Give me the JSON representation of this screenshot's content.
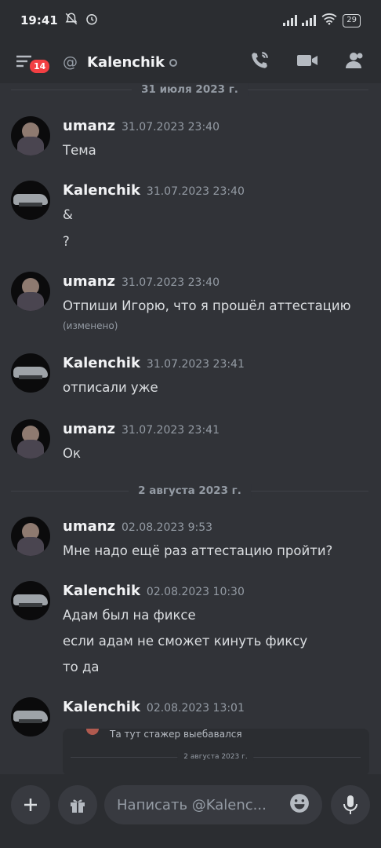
{
  "status": {
    "time": "19:41",
    "battery": "29"
  },
  "header": {
    "badge": "14",
    "channel": "Kalenchik"
  },
  "dividers": [
    "31 июля 2023 г.",
    "2 августа 2023 г."
  ],
  "messages": [
    {
      "author": "umanz",
      "time": "31.07.2023 23:40",
      "lines": [
        "Тема"
      ],
      "avatar": "girl"
    },
    {
      "author": "Kalenchik",
      "time": "31.07.2023 23:40",
      "lines": [
        "&",
        "?"
      ],
      "avatar": "car"
    },
    {
      "author": "umanz",
      "time": "31.07.2023 23:40",
      "lines": [
        "Отпиши Игорю, что я прошёл аттестацию"
      ],
      "edited": "(изменено)",
      "avatar": "girl"
    },
    {
      "author": "Kalenchik",
      "time": "31.07.2023 23:41",
      "lines": [
        "отписали уже"
      ],
      "avatar": "car"
    },
    {
      "author": "umanz",
      "time": "31.07.2023 23:41",
      "lines": [
        "Ок"
      ],
      "avatar": "girl"
    },
    {
      "author": "umanz",
      "time": "02.08.2023 9:53",
      "lines": [
        "Мне надо ещё раз аттестацию пройти?"
      ],
      "avatar": "girl"
    },
    {
      "author": "Kalenchik",
      "time": "02.08.2023 10:30",
      "lines": [
        "Адам был на фиксе",
        "если адам не сможет кинуть фиксу",
        "то да"
      ],
      "avatar": "car"
    },
    {
      "author": "Kalenchik",
      "time": "02.08.2023 13:01",
      "lines": [],
      "avatar": "car"
    }
  ],
  "embed": {
    "text": "Та тут стажер выебавался",
    "divider": "2 августа 2023 г."
  },
  "composer": {
    "placeholder": "Написать @Kalenc..."
  }
}
